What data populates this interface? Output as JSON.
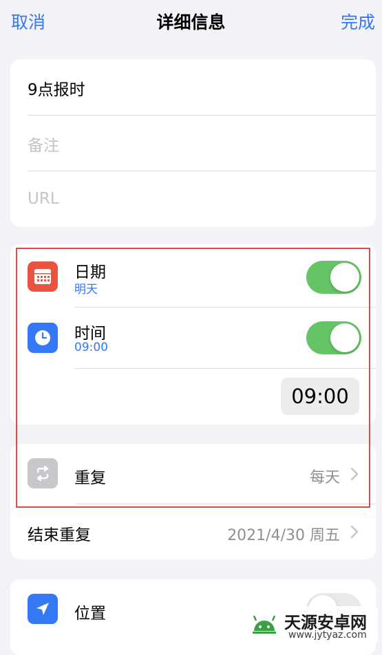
{
  "nav": {
    "cancel": "取消",
    "title": "详细信息",
    "done": "完成"
  },
  "fields": {
    "title": "9点报时",
    "notes_placeholder": "备注",
    "url_placeholder": "URL"
  },
  "date_row": {
    "label": "日期",
    "value": "明天",
    "enabled": true
  },
  "time_row": {
    "label": "时间",
    "value": "09:00",
    "enabled": true,
    "picker_value": "09:00"
  },
  "repeat_row": {
    "label": "重复",
    "value": "每天"
  },
  "end_repeat_row": {
    "label": "结束重复",
    "value": "2021/4/30 周五"
  },
  "location_row": {
    "label": "位置",
    "enabled": false
  },
  "watermark": {
    "text": "天源安卓网",
    "url": "www.jytyaz.com"
  },
  "colors": {
    "accent": "#3478f6",
    "toggle_on": "#65c466",
    "calendar_icon": "#e8543f",
    "location_icon": "#3478f6",
    "highlight": "#e04a42"
  },
  "icons": {
    "date": "calendar-icon",
    "time": "clock-icon",
    "repeat": "repeat-icon",
    "location": "location-arrow-icon"
  }
}
